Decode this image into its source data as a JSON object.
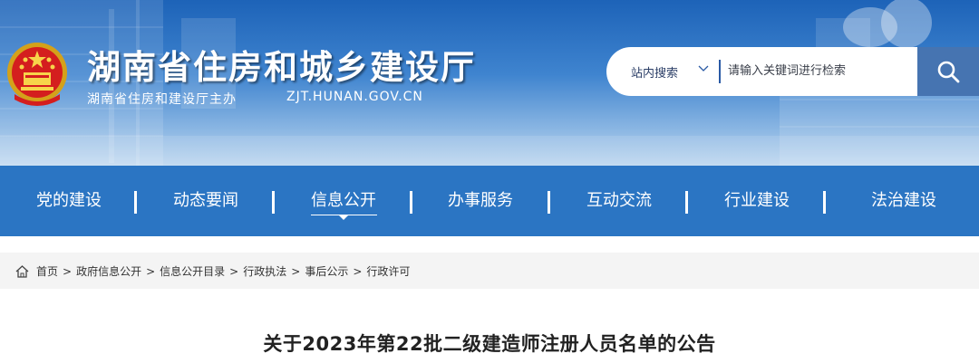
{
  "header": {
    "site_title": "湖南省住房和城乡建设厅",
    "sponsor": "湖南省住房和建设厅主办",
    "domain": "ZJT.HUNAN.GOV.CN",
    "emblem_icon": "national-emblem-icon"
  },
  "search": {
    "scope_label": "站内搜索",
    "placeholder": "请输入关键词进行检索",
    "button_icon": "search-icon"
  },
  "nav": {
    "items": [
      {
        "label": "党的建设"
      },
      {
        "label": "动态要闻"
      },
      {
        "label": "信息公开",
        "active": true
      },
      {
        "label": "办事服务"
      },
      {
        "label": "互动交流"
      },
      {
        "label": "行业建设"
      },
      {
        "label": "法治建设"
      }
    ]
  },
  "breadcrumb": {
    "items": [
      "首页",
      "政府信息公开",
      "信息公开目录",
      "行政执法",
      "事后公示",
      "行政许可"
    ],
    "separator": ">"
  },
  "article": {
    "title": "关于2023年第22批二级建造师注册人员名单的公告"
  },
  "colors": {
    "nav_bg": "#2b75c3",
    "search_button": "#4674b1",
    "breadcrumb_bg": "#f4f4f4"
  }
}
